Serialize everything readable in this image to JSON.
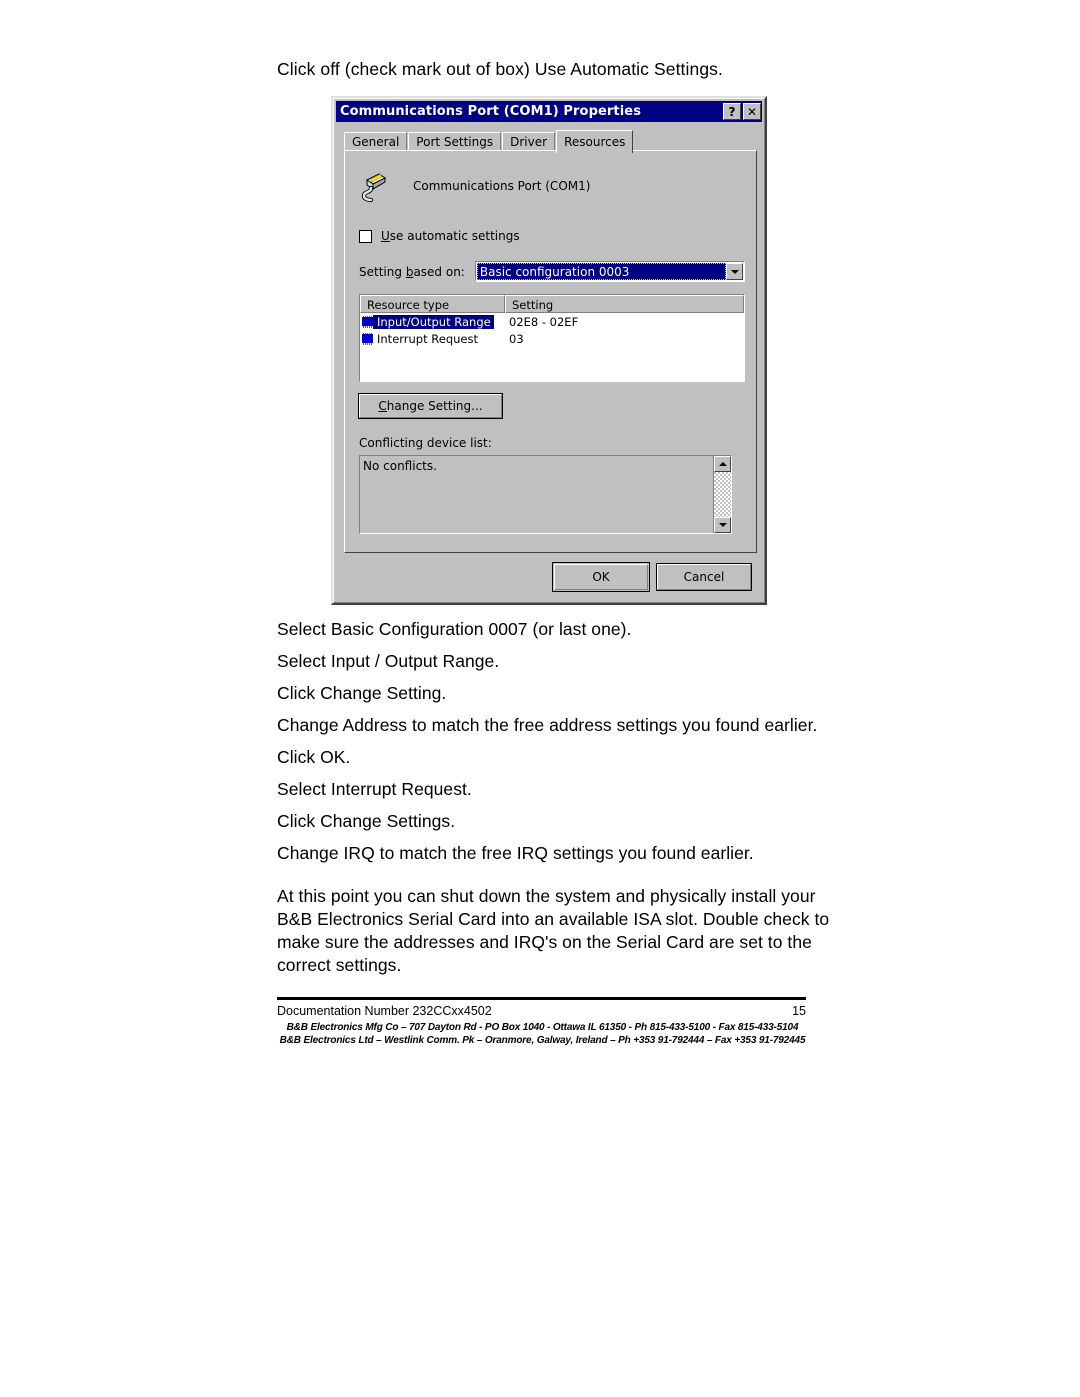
{
  "document": {
    "intro_line": "Click off (check mark out of box) Use Automatic Settings.",
    "steps": [
      "Select Basic Configuration 0007 (or last one).",
      "Select Input / Output Range.",
      "Click Change Setting.",
      "Change Address to match the free address settings you found earlier.",
      "Click OK.",
      "Select Interrupt Request.",
      "Click Change Settings.",
      "Change IRQ to match the free IRQ settings you found earlier."
    ],
    "closing_paragraph": "At this point you can shut down the system and physically install your B&B Electronics Serial Card into an available ISA slot. Double check to make sure the addresses and IRQ's on the Serial Card are set to the correct settings."
  },
  "footer": {
    "doc_number": "Documentation Number 232CCxx4502",
    "page_number": "15",
    "address_line_1": "B&B Electronics Mfg Co – 707 Dayton Rd - PO Box 1040 - Ottawa IL 61350 - Ph 815-433-5100 - Fax 815-433-5104",
    "address_line_2": "B&B Electronics Ltd – Westlink Comm. Pk – Oranmore, Galway, Ireland – Ph +353 91-792444 – Fax +353 91-792445"
  },
  "dialog": {
    "title": "Communications Port (COM1) Properties",
    "title_buttons": {
      "help": "?",
      "close": "✕"
    },
    "tabs": [
      {
        "label": "General",
        "active": false
      },
      {
        "label": "Port Settings",
        "active": false
      },
      {
        "label": "Driver",
        "active": false
      },
      {
        "label": "Resources",
        "active": true
      }
    ],
    "device_name": "Communications Port (COM1)",
    "auto_settings": {
      "label_prefix": "U",
      "label_rest": "se automatic settings",
      "checked": false
    },
    "setting_based_on": {
      "label_1": "Settin",
      "label_2": "g",
      "label_3": " ",
      "label_4": "b",
      "label_5": "ased on:",
      "label_full": "Setting based on:",
      "value": "Basic configuration 0003"
    },
    "resource_table": {
      "columns": [
        "Resource type",
        "Setting"
      ],
      "rows": [
        {
          "type": "Input/Output Range",
          "value": "02E8 - 02EF",
          "selected": true
        },
        {
          "type": "Interrupt Request",
          "value": "03",
          "selected": false
        }
      ]
    },
    "change_setting_button": "Change Setting...",
    "conflict_label": "Conflicting device list:",
    "conflict_text": "No conflicts.",
    "buttons": {
      "ok": "OK",
      "cancel": "Cancel"
    }
  },
  "colors": {
    "titlebar": "#000080",
    "face": "#c0c0c0",
    "highlight": "#000080",
    "selection_text": "#ffffff"
  }
}
